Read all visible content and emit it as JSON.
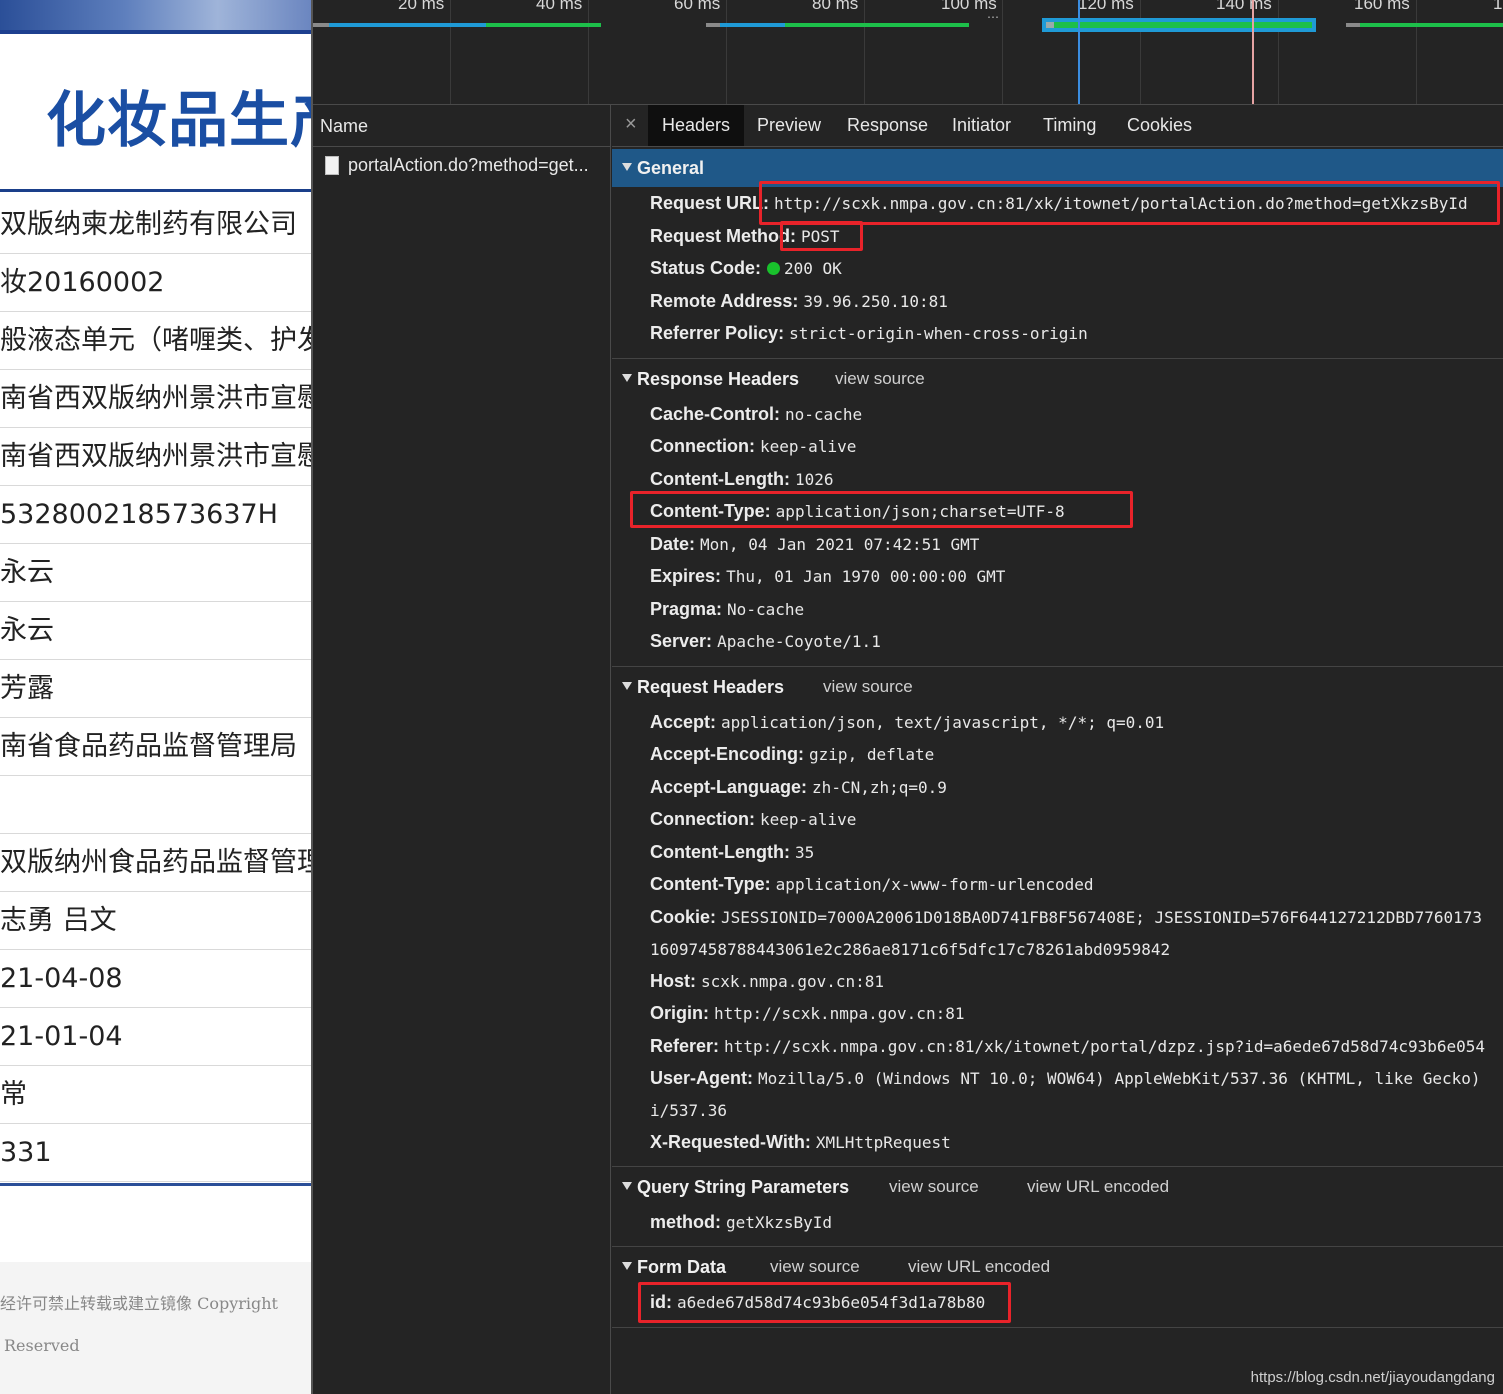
{
  "page": {
    "title": "化妆品生产",
    "rows": [
      "双版纳柬龙制药有限公司",
      "妆20160002",
      "般液态单元（啫喱类、护发清",
      "南省西双版纳州景洪市宣慰大",
      "南省西双版纳州景洪市宣慰大",
      "532800218573637H",
      "永云",
      "永云",
      "芳露",
      "南省食品药品监督管理局",
      "",
      "双版纳州食品药品监督管理局",
      "志勇 吕文",
      "21-04-08",
      "21-01-04",
      "常",
      "331"
    ],
    "footer_line1": "经许可禁止转载或建立镜像 Copyright",
    "footer_line2": "Reserved"
  },
  "timeline": {
    "ticks": [
      "20 ms",
      "40 ms",
      "60 ms",
      "80 ms",
      "100 ms",
      "120 ms",
      "140 ms",
      "160 ms",
      "1"
    ]
  },
  "network": {
    "name_header": "Name",
    "request_name": "portalAction.do?method=get..."
  },
  "tabs": {
    "close": "×",
    "headers": "Headers",
    "preview": "Preview",
    "response": "Response",
    "initiator": "Initiator",
    "timing": "Timing",
    "cookies": "Cookies"
  },
  "general": {
    "title": "General",
    "request_url_k": "Request URL:",
    "request_url_v": "http://scxk.nmpa.gov.cn:81/xk/itownet/portalAction.do?method=getXkzsById",
    "request_method_k": "Request Method:",
    "request_method_v": "POST",
    "status_code_k": "Status Code:",
    "status_code_v": "200 OK",
    "remote_address_k": "Remote Address:",
    "remote_address_v": "39.96.250.10:81",
    "referrer_policy_k": "Referrer Policy:",
    "referrer_policy_v": "strict-origin-when-cross-origin"
  },
  "response_headers": {
    "title": "Response Headers",
    "view_source": "view source",
    "cache_control_k": "Cache-Control:",
    "cache_control_v": "no-cache",
    "connection_k": "Connection:",
    "connection_v": "keep-alive",
    "content_length_k": "Content-Length:",
    "content_length_v": "1026",
    "content_type_k": "Content-Type:",
    "content_type_v": "application/json;charset=UTF-8",
    "date_k": "Date:",
    "date_v": "Mon, 04 Jan 2021 07:42:51 GMT",
    "expires_k": "Expires:",
    "expires_v": "Thu, 01 Jan 1970 00:00:00 GMT",
    "pragma_k": "Pragma:",
    "pragma_v": "No-cache",
    "server_k": "Server:",
    "server_v": "Apache-Coyote/1.1"
  },
  "request_headers": {
    "title": "Request Headers",
    "view_source": "view source",
    "accept_k": "Accept:",
    "accept_v": "application/json, text/javascript, */*; q=0.01",
    "accept_encoding_k": "Accept-Encoding:",
    "accept_encoding_v": "gzip, deflate",
    "accept_language_k": "Accept-Language:",
    "accept_language_v": "zh-CN,zh;q=0.9",
    "connection_k": "Connection:",
    "connection_v": "keep-alive",
    "content_length_k": "Content-Length:",
    "content_length_v": "35",
    "content_type_k": "Content-Type:",
    "content_type_v": "application/x-www-form-urlencoded",
    "cookie_k": "Cookie:",
    "cookie_v1": "JSESSIONID=7000A20061D018BA0D741FB8F567408E; JSESSIONID=576F644127212DBD7760173",
    "cookie_v2": "16097458788443061e2c286ae8171c6f5dfc17c78261abd0959842",
    "host_k": "Host:",
    "host_v": "scxk.nmpa.gov.cn:81",
    "origin_k": "Origin:",
    "origin_v": "http://scxk.nmpa.gov.cn:81",
    "referer_k": "Referer:",
    "referer_v": "http://scxk.nmpa.gov.cn:81/xk/itownet/portal/dzpz.jsp?id=a6ede67d58d74c93b6e054",
    "user_agent_k": "User-Agent:",
    "user_agent_v1": "Mozilla/5.0 (Windows NT 10.0; WOW64) AppleWebKit/537.36 (KHTML, like Gecko)",
    "user_agent_v2": "i/537.36",
    "x_requested_with_k": "X-Requested-With:",
    "x_requested_with_v": "XMLHttpRequest"
  },
  "query_string": {
    "title": "Query String Parameters",
    "view_source": "view source",
    "view_url_encoded": "view URL encoded",
    "method_k": "method:",
    "method_v": "getXkzsById"
  },
  "form_data": {
    "title": "Form Data",
    "view_source": "view source",
    "view_url_encoded": "view URL encoded",
    "id_k": "id:",
    "id_v": "a6ede67d58d74c93b6e054f3d1a78b80"
  },
  "watermark": "https://blog.csdn.net/jiayoudangdang",
  "colors": {
    "highlight_box": "#e8232a",
    "section_bar": "#1f5888",
    "status_ok": "#19c12c",
    "page_title": "#1a4ea3"
  }
}
